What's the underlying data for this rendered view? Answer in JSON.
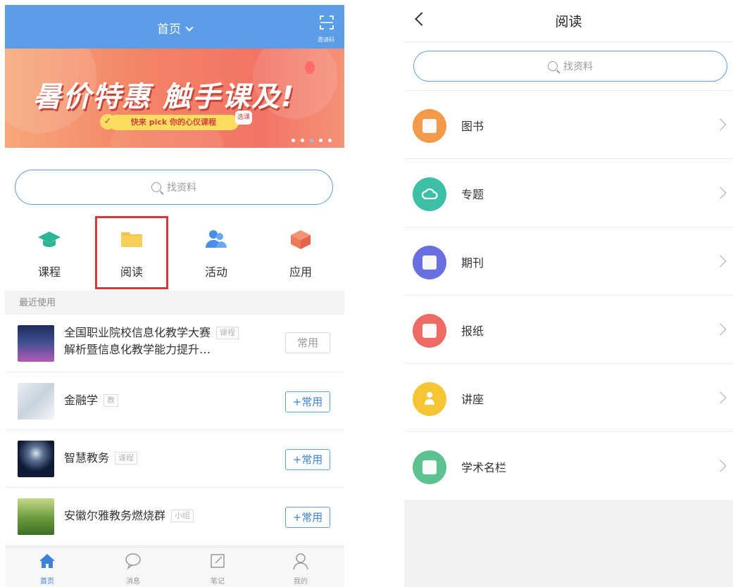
{
  "left": {
    "header": {
      "title": "首页",
      "scan_label": "邀请码"
    },
    "banner": {
      "headline": "暑价特惠 触手课及!",
      "pill_text": "快来 pick 你的心仪课程",
      "book_text": "选课",
      "dots_total": 5,
      "dots_active_index": 2
    },
    "search": {
      "placeholder": "找资料"
    },
    "menu": [
      {
        "label": "课程",
        "icon": "graduation-cap-icon",
        "color": "#2bb594"
      },
      {
        "label": "阅读",
        "icon": "folder-icon",
        "color": "#f5c34a"
      },
      {
        "label": "活动",
        "icon": "people-icon",
        "color": "#4a8fe6"
      },
      {
        "label": "应用",
        "icon": "cube-icon",
        "color": "#ef7a5a"
      }
    ],
    "recent": {
      "header": "最近使用",
      "items": [
        {
          "title": "全国职业院校信息化教学大赛解析暨信息化教学能力提升…",
          "title_line1": "全国职业院校信息化教学大赛",
          "title_line2": "解析暨信息化教学能力提升…",
          "tag": "课程",
          "button": "常用",
          "button_style": "gray"
        },
        {
          "title": "金融学",
          "tag": "教",
          "button": "+常用",
          "button_style": "blue"
        },
        {
          "title": "智慧教务",
          "tag": "课程",
          "button": "+常用",
          "button_style": "blue"
        },
        {
          "title": "安徽尔雅教务燃烧群",
          "tag": "小组",
          "button": "+常用",
          "button_style": "blue"
        }
      ]
    },
    "tabbar": [
      {
        "label": "首页",
        "icon": "home-icon",
        "active": true
      },
      {
        "label": "消息",
        "icon": "chat-icon",
        "active": false
      },
      {
        "label": "笔记",
        "icon": "note-icon",
        "active": false
      },
      {
        "label": "我的",
        "icon": "user-icon",
        "active": false
      }
    ],
    "highlight_color": "#d9383a"
  },
  "right": {
    "header": {
      "title": "阅读"
    },
    "search": {
      "placeholder": "找资料"
    },
    "items": [
      {
        "label": "图书",
        "icon": "book-icon",
        "color": "#f39a4a"
      },
      {
        "label": "专题",
        "icon": "cloud-icon",
        "color": "#3dbfa5"
      },
      {
        "label": "期刊",
        "icon": "journal-icon",
        "color": "#6a6fe0"
      },
      {
        "label": "报纸",
        "icon": "newspaper-icon",
        "color": "#ee6a64"
      },
      {
        "label": "讲座",
        "icon": "lecture-icon",
        "color": "#f5c535"
      },
      {
        "label": "学术名栏",
        "icon": "academic-icon",
        "color": "#5cc28f"
      }
    ]
  },
  "colors": {
    "primary": "#5b9de6",
    "banner": "#f48467"
  }
}
